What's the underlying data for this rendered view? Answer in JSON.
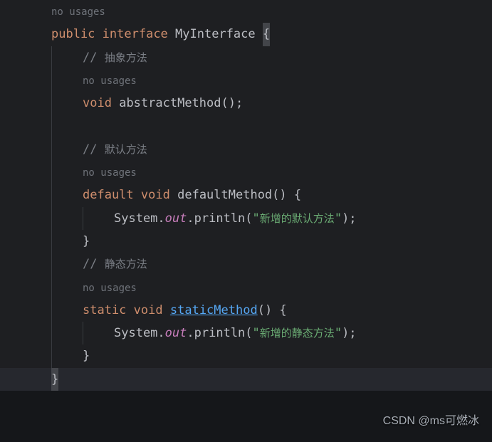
{
  "hints": {
    "no_usages_1": "no usages",
    "no_usages_2": "no usages",
    "no_usages_3": "no usages",
    "no_usages_4": "no usages"
  },
  "code": {
    "kw_public": "public",
    "kw_interface": "interface",
    "iface_name": "MyInterface",
    "open_brace": "{",
    "close_brace": "}",
    "c1_slashes": "// ",
    "c1_text": "抽象方法",
    "m1_kw_void": "void",
    "m1_name": "abstractMethod",
    "m1_tail": "();",
    "c2_slashes": "// ",
    "c2_text": "默认方法",
    "m2_kw_default": "default",
    "m2_kw_void": "void",
    "m2_name": "defaultMethod",
    "m2_sig_tail": "() {",
    "m2_sys": "System",
    "m2_dot1": ".",
    "m2_out": "out",
    "m2_dot2": ".",
    "m2_println": "println",
    "m2_open": "(",
    "m2_str_q1": "\"",
    "m2_str_body": "新增的默认方法",
    "m2_str_q2": "\"",
    "m2_close": ");",
    "m2_cb": "}",
    "c3_slashes": "// ",
    "c3_text": "静态方法",
    "m3_kw_static": "static",
    "m3_kw_void": "void",
    "m3_name": "staticMethod",
    "m3_sig_tail": "() {",
    "m3_sys": "System",
    "m3_dot1": ".",
    "m3_out": "out",
    "m3_dot2": ".",
    "m3_println": "println",
    "m3_open": "(",
    "m3_str_q1": "\"",
    "m3_str_body": "新增的静态方法",
    "m3_str_q2": "\"",
    "m3_close": ");",
    "m3_cb": "}"
  },
  "watermark": "CSDN @ms可燃冰"
}
